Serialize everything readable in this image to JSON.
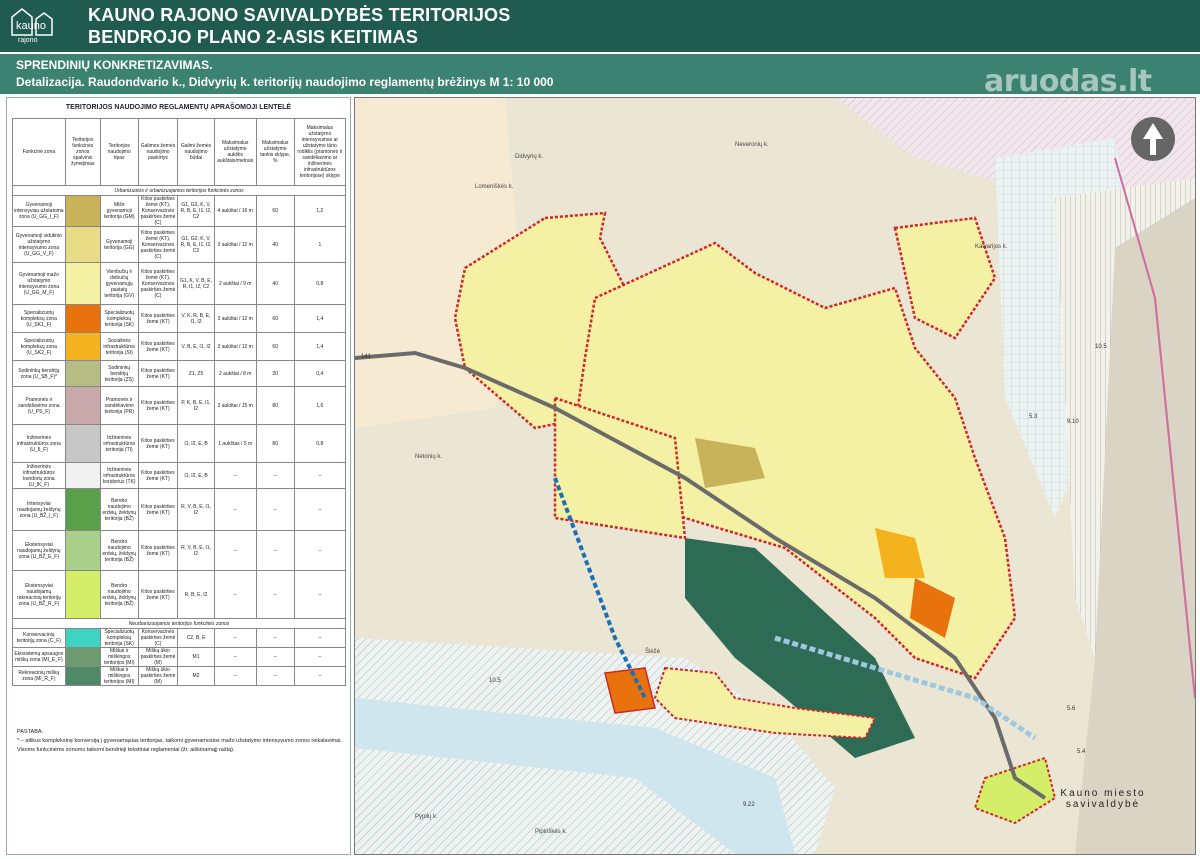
{
  "header": {
    "logo_text": "kauno rajono",
    "title_line1": "KAUNO RAJONO SAVIVALDYBĖS TERITORIJOS",
    "title_line2": "BENDROJO PLANO 2-ASIS KEITIMAS"
  },
  "subheader": {
    "line1": "SPRENDINIŲ KONKRETIZAVIMAS.",
    "line2": "Detalizacija. Raudondvario k., Didvyrių k. teritorijų naudojimo reglamentų brėžinys M 1: 10 000"
  },
  "watermark": "aruodas.lt",
  "legend": {
    "title": "TERITORIJOS NAUDOJIMO REGLAMENTŲ APRAŠOMOJI LENTELĖ",
    "headers": [
      "Funkcinė zona",
      "Teritorijos funkcinės zonos spalvinis žymėjimas",
      "Teritorijos naudojimo tipas",
      "Galimos žemės naudojimo paskirtys",
      "Galimi žemės naudojimo būdai",
      "Maksimalus užstatymo aukštis aukštais/metrais",
      "Maksimalus užstatymo tankis sklype, %",
      "Maksimalus užstatymo intensyvumas ar užstatymo tūrio rodiklis (pramonės ir sandėliavimo ar inžinerinės infrastruktūros teritorijose) sklype"
    ],
    "section_urban": "Urbanizuotos ir urbanizuojamos teritorijos funkcinės zonos",
    "section_nonurban": "Neurbanizuojamos teritorijos funkcinės zonos",
    "rows": [
      {
        "zone": "Gyvenamoji intensyviau užstatoma zona (U_GG_I_F)",
        "color": "#c8b35a",
        "type": "Mišri gyvenamoji teritorija (GM)",
        "purposes": "Kitos paskirties žemė (KT), Konservacinės paskirties žemė (C)",
        "uses": "G1, G2, K, V, R, B, E, I1, I2, C2",
        "height": "4 aukštai / 16 m",
        "density": "60",
        "intensity": "1,2"
      },
      {
        "zone": "Gyvenamoji vidutinio užstatymo intensyvumo zona (U_GG_V_F)",
        "color": "#e8dc86",
        "type": "Gyvenamoji teritorija (GG)",
        "purposes": "Kitos paskirties žemė (KT), Konservacinės paskirties žemė (C)",
        "uses": "G1, G2, K, V, R, B, E, I1, I2, C2",
        "height": "3 aukštai / 12 m",
        "density": "40",
        "intensity": "1"
      },
      {
        "zone": "Gyvenamoji mažo užstatymo intensyvumo zona (U_GG_M_F)",
        "color": "#f4f0a4",
        "type": "Vienbučių ir dvibučių gyvenamųjų pastatų teritorija (GV)",
        "purposes": "Kitos paskirties žemė (KT), Konservacinės paskirties žemė (C)",
        "uses": "G1, K, V, B, E, R, I1, I2, C2",
        "height": "2 aukštai / 9 m",
        "density": "40",
        "intensity": "0,8"
      },
      {
        "zone": "Specializuotų kompleksų zona (U_SK1_F)",
        "color": "#e8720c",
        "type": "Specializuotų kompleksų teritorija (SK)",
        "purposes": "Kitos paskirties žemė (KT)",
        "uses": "V, K, R, B, E, I1, I2",
        "height": "3 aukštai / 12 m",
        "density": "60",
        "intensity": "1,4"
      },
      {
        "zone": "Specializuotų kompleksų zona (U_SK2_F)",
        "color": "#f3b21e",
        "type": "Socialinės infrastruktūros teritorija (SI)",
        "purposes": "Kitos paskirties žemė (KT)",
        "uses": "V, B, E, I1, I2",
        "height": "3 aukštai / 12 m",
        "density": "60",
        "intensity": "1,4"
      },
      {
        "zone": "Sodininkų bendrijų zona (U_SB_F)*",
        "color": "#b5bd85",
        "type": "Sodininkų bendrijų teritorija (ZS)",
        "purposes": "Kitos paskirties žemė (KT)",
        "uses": "Z1, Z5",
        "height": "2 aukštai / 8 m",
        "density": "20",
        "intensity": "0,4"
      },
      {
        "zone": "Pramonės ir sandėliavimo zona (U_PS_F)",
        "color": "#c9a9a9",
        "type": "Pramonės ir sandėliavimo teritorija (PR)",
        "purposes": "Kitos paskirties žemė (KT)",
        "uses": "P, K, B, E, I1, I2",
        "height": "3 aukštai / 15 m",
        "density": "80",
        "intensity": "1,6"
      },
      {
        "zone": "Inžinerinės infrastruktūros zona (U_II_F)",
        "color": "#c7c7c7",
        "type": "Inžinerinės infrastruktūros teritorija (TI)",
        "purposes": "Kitos paskirties žemė (KT)",
        "uses": "I1, I2, E, B",
        "height": "1 aukštas / 5 m",
        "density": "80",
        "intensity": "0,8"
      },
      {
        "zone": "Inžinerinės infrastruktūros koridorių zona (U_IK_F)",
        "color": "#f1f1f1",
        "type": "Inžinerinės infrastruktūros koridorius (TK)",
        "purposes": "Kitos paskirties žemė (KT)",
        "uses": "I1, I2, E, B",
        "height": "–",
        "density": "–",
        "intensity": "–"
      },
      {
        "zone": "Intensyviai naudojamų želdynų zona (U_BŽ_I_F)",
        "color": "#5aa04a",
        "type": "Bendro naudojimo erdvių, želdynų teritorija (BŽ)",
        "purposes": "Kitos paskirties žemė (KT)",
        "uses": "R, V, B, E, I1, I2",
        "height": "–",
        "density": "–",
        "intensity": "–"
      },
      {
        "zone": "Ekstensyviai naudojamų želdynų zona (U_BŽ_E_F)",
        "color": "#a8d08a",
        "type": "Bendro naudojimo erdvių, želdynų teritorija (BŽ)",
        "purposes": "Kitos paskirties žemė (KT)",
        "uses": "R, V, B, E, I1, I2",
        "height": "–",
        "density": "–",
        "intensity": "–"
      },
      {
        "zone": "Ekstensyviai naudojamų rekreacinių teritorijų zona (U_BŽ_R_F)",
        "color": "#d4ee6a",
        "type": "Bendro naudojimo erdvių, želdynų teritorija (BŽ)",
        "purposes": "Kitos paskirties žemė (KT)",
        "uses": "R, B, E, I2",
        "height": "–",
        "density": "–",
        "intensity": "–"
      },
      {
        "zone": "Konservacinių teritorijų zona (C_F)",
        "color": "#3fd4c2",
        "type": "Specializuotų kompleksų teritorija (SK)",
        "purposes": "Konservacinės paskirties žemė (C)",
        "uses": "C2, B, E",
        "height": "–",
        "density": "–",
        "intensity": "–"
      },
      {
        "zone": "Ekosistemų apsaugos miškų zona (MI_E_F)",
        "color": "#6e9b70",
        "type": "Miškai ir miškingos teritorijos (MI)",
        "purposes": "Miškų ūkio paskirties žemė (M)",
        "uses": "M1",
        "height": "–",
        "density": "–",
        "intensity": "–"
      },
      {
        "zone": "Rekreacinių miškų zona (MI_R_F)",
        "color": "#4e8968",
        "type": "Miškai ir miškingos teritorijos (MI)",
        "purposes": "Miškų ūkio paskirties žemė (M)",
        "uses": "M2",
        "height": "–",
        "density": "–",
        "intensity": "–"
      }
    ],
    "notes_title": "PASTABA:",
    "note1": "* – atlikus kompleksinę konversiją į gyvenamąsias teritorijas, taikomi gyvenamosios mažo užstatymo intensyvumo zonos reikalavimai.",
    "note2": "Visoms funkcinėms zonoms taikomi bendrieji tekstiniai reglamentai (žr. aiškinamąjį raštą)."
  },
  "map": {
    "city_label_line1": "Kauno miesto",
    "city_label_line2": "savivaldybė",
    "place_labels": [
      "Didvyrių k.",
      "Netonių k.",
      "Neveronių k.",
      "Lomeniškės k.",
      "Šlėžė",
      "Pipiriškės k.",
      "Kalvarijos k.",
      "Pyplių k."
    ],
    "road_labels": [
      "141",
      "10.5",
      "5.3",
      "9.10",
      "5.6",
      "5.4",
      "9.22",
      "10.5"
    ],
    "north_arrow": "north-arrow-icon",
    "colors": {
      "main_residential": "#f4f0a4",
      "dense_residential": "#c8b35a",
      "boundary": "#d0262a",
      "forest": "#2e6b55",
      "water": "#cfe6ee",
      "road": "#6b6b6b"
    }
  }
}
